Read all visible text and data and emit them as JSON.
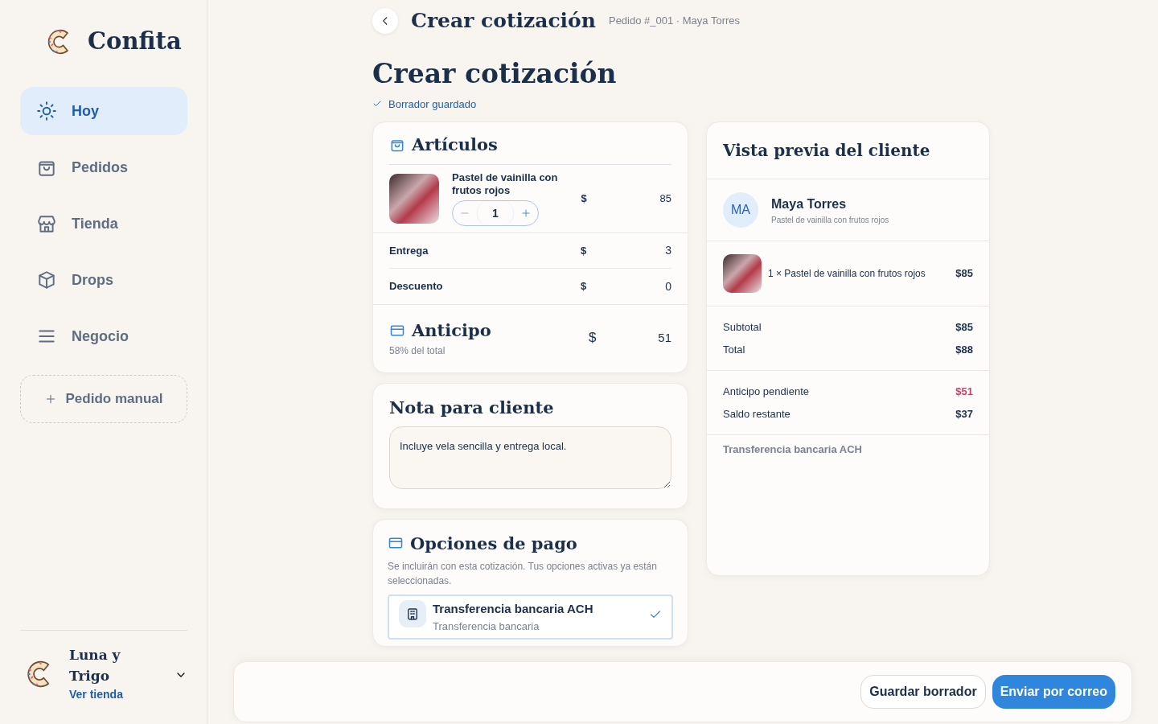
{
  "sidebar": {
    "brand": "Confita",
    "nav": [
      {
        "label": "Hoy",
        "selected": true
      },
      {
        "label": "Pedidos",
        "selected": false
      },
      {
        "label": "Tienda",
        "selected": false
      },
      {
        "label": "Drops",
        "selected": false
      },
      {
        "label": "Negocio",
        "selected": false
      }
    ],
    "manual_order_button": "Pedido manual",
    "account": {
      "name": "Luna y Trigo",
      "link": "Ver tienda"
    }
  },
  "header": {
    "title": "Crear cotización",
    "subtitle": "Pedido #_001 · Maya Torres"
  },
  "page_title": "Crear cotización",
  "save_status": "Borrador guardado",
  "articles": {
    "title": "Artículos",
    "items": [
      {
        "name": "Pastel de vainilla con frutos rojos",
        "quantity": "1",
        "currency": "$",
        "price": "85"
      }
    ],
    "charges": [
      {
        "label": "Entrega",
        "currency": "$",
        "value": "3"
      },
      {
        "label": "Descuento",
        "currency": "$",
        "value": "0"
      }
    ],
    "deposit": {
      "title": "Anticipo",
      "note": "58% del total",
      "currency": "$",
      "value": "51"
    }
  },
  "note": {
    "title": "Nota para cliente",
    "value": "Incluye vela sencilla y entrega local."
  },
  "payment": {
    "title": "Opciones de pago",
    "description": "Se incluirán con esta cotización. Tus opciones activas ya están seleccionadas.",
    "options": [
      {
        "name": "Transferencia bancaria ACH",
        "detail": "Transferencia bancaria",
        "checked": true
      }
    ]
  },
  "preview": {
    "title": "Vista previa del cliente",
    "customer": {
      "initials": "MA",
      "name": "Maya Torres",
      "detail": "Pastel de vainilla con frutos rojos"
    },
    "lines": [
      {
        "text": "1 × Pastel de vainilla con frutos rojos",
        "amount": "$85"
      }
    ],
    "totals": [
      {
        "label": "Subtotal",
        "amount": "$85"
      },
      {
        "label": "Total",
        "amount": "$88"
      }
    ],
    "balance": [
      {
        "label": "Anticipo pendiente",
        "amount": "$51",
        "kind": "due"
      },
      {
        "label": "Saldo restante",
        "amount": "$37",
        "kind": "plain"
      }
    ],
    "payment_method": "Transferencia bancaria ACH"
  },
  "footer": {
    "buttons": [
      {
        "label": "Guardar borrador",
        "kind": "secondary"
      },
      {
        "label": "Enviar por correo",
        "kind": "primary"
      }
    ]
  }
}
